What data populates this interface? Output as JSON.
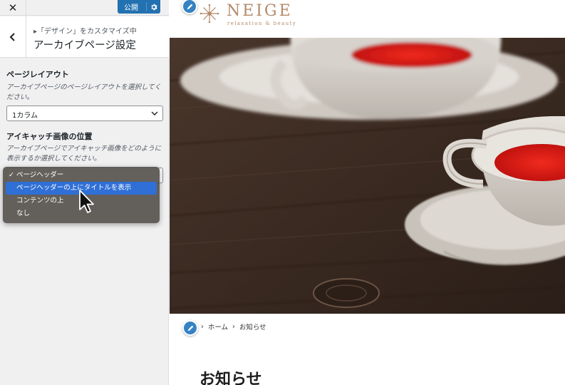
{
  "customizer": {
    "close_icon": "close-icon",
    "publish_label": "公開",
    "settings_icon": "gear-icon",
    "back_icon": "chevron-left-icon",
    "breadcrumb": "▸「デザイン」をカスタマイズ中",
    "section_title": "アーカイブページ設定",
    "layout": {
      "label": "ページレイアウト",
      "description": "アーカイブページのページレイアウトを選択してください。",
      "selected": "1カラム"
    },
    "eyecatch": {
      "label": "アイキャッチ画像の位置",
      "description": "アーカイブページでアイキャッチ画像をどのように表示するか選択してください。",
      "options": [
        "ページヘッダー",
        "ページヘッダーの上にタイトルを表示",
        "コンテンツの上",
        "なし"
      ],
      "checked": "✓",
      "highlighted_index": 1
    }
  },
  "preview": {
    "logo_text": "NEIGE",
    "logo_tagline": "relaxation & beauty",
    "breadcrumb": {
      "home": "ホーム",
      "current": "お知らせ",
      "separator": "›"
    },
    "heading": "お知らせ",
    "accent_color": "#b48a6a",
    "edit_icon": "pencil-icon"
  }
}
